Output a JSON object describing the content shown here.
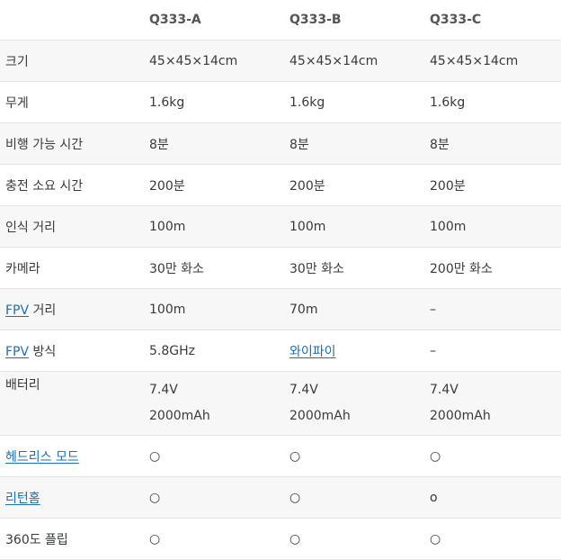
{
  "header": {
    "col0": "",
    "col1": "Q333-A",
    "col2": "Q333-B",
    "col3": "Q333-C"
  },
  "rows": [
    {
      "label": "크기",
      "a": "45×45×14cm",
      "b": "45×45×14cm",
      "c": "45×45×14cm"
    },
    {
      "label": "무게",
      "a": "1.6kg",
      "b": "1.6kg",
      "c": "1.6kg"
    },
    {
      "label": "비행 가능 시간",
      "a": "8분",
      "b": "8분",
      "c": "8분"
    },
    {
      "label": "충전 소요 시간",
      "a": "200분",
      "b": "200분",
      "c": "200분"
    },
    {
      "label": "인식 거리",
      "a": "100m",
      "b": "100m",
      "c": "100m"
    },
    {
      "label": "카메라",
      "a": "30만 화소",
      "b": "30만 화소",
      "c": "200만 화소"
    },
    {
      "label_link": "FPV",
      "label_rest": " 거리",
      "a": "100m",
      "b": "70m",
      "c": "–"
    },
    {
      "label_link": "FPV",
      "label_rest": " 방식",
      "a": "5.8GHz",
      "b": "와이파이",
      "c": "–"
    },
    {
      "label": "배터리",
      "a1": "7.4V",
      "a2": "2000mAh",
      "b1": "7.4V",
      "b2": "2000mAh",
      "c1": "7.4V",
      "c2": "2000mAh"
    },
    {
      "label": "헤드리스 모드",
      "a": "○",
      "b": "○",
      "c": "○"
    },
    {
      "label": "리턴홈",
      "a": "○",
      "b": "○",
      "c": "o"
    },
    {
      "label": "360도 플립",
      "a": "○",
      "b": "○",
      "c": "○"
    }
  ],
  "colors": {
    "link": "#1a6fb5",
    "stripe": "#f7f7f7",
    "border": "#e3e3e3",
    "text": "#373a3c"
  }
}
